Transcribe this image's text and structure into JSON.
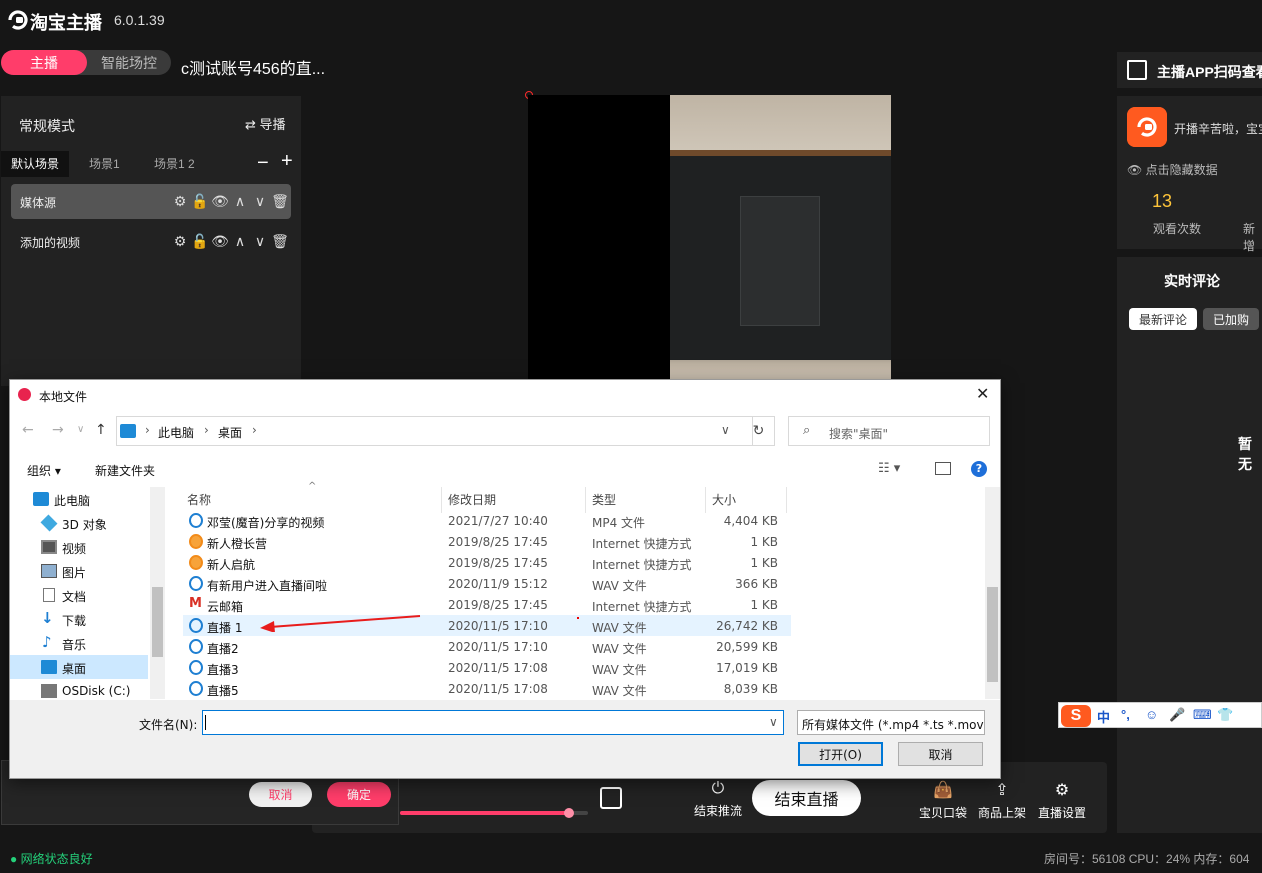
{
  "app": {
    "title": "淘宝主播",
    "version": "6.0.1.39",
    "role_tabs": [
      "主播",
      "智能场控"
    ],
    "room_title": "c测试账号456的直..."
  },
  "left_panel": {
    "mode": "常规模式",
    "director_label": "导播",
    "director_icon": "⇄",
    "scene_tabs": [
      "默认场景",
      "场景1",
      "场景1 2"
    ],
    "minus": "−",
    "plus": "+",
    "sources": [
      {
        "name": "媒体源"
      },
      {
        "name": "添加的视频"
      }
    ],
    "tool_icons": [
      "⚙",
      "🔓",
      "👁",
      "∧",
      "∨",
      "🗑"
    ]
  },
  "right_panel": {
    "qr_label": "主播APP扫码查看",
    "hello": "开播辛苦啦，宝宝",
    "hide_data": "点击隐藏数据",
    "views_value": "13",
    "views_label": "观看次数",
    "new_label": "新增",
    "comments_title": "实时评论",
    "tab_latest": "最新评论",
    "tab_cart": "已加购",
    "empty_text": "暂无"
  },
  "control_bar": {
    "volume_level": 0.9,
    "stop_push": "结束推流",
    "end_live": "结束直播",
    "bag": "宝贝口袋",
    "listing": "商品上架",
    "settings": "直播设置",
    "stop_icon": "⏻",
    "bag_icon": "👜",
    "listing_icon": "⇪",
    "settings_icon": "⚙"
  },
  "popup": {
    "cancel": "取消",
    "ok": "确定"
  },
  "status": {
    "network": "● 网络状态良好",
    "system": "房间号：56108  CPU：24%  内存：604"
  },
  "ime": {
    "logo": "S",
    "items": [
      "中",
      "°,",
      "☺",
      "🎤",
      "⌨",
      "👕"
    ]
  },
  "dialog": {
    "title": "本地文件",
    "close": "✕",
    "breadcrumb": [
      "此电脑",
      "桌面"
    ],
    "search_placeholder": "搜索\"桌面\"",
    "organize": "组织 ▾",
    "new_folder": "新建文件夹",
    "view_icon": "☷ ▾",
    "help": "?",
    "tree": [
      {
        "label": "此电脑",
        "icon": "pc-icon",
        "color": "#1e8ad6"
      },
      {
        "label": "3D 对象",
        "icon": "cube-icon",
        "color": "#3fa9e0"
      },
      {
        "label": "视频",
        "icon": "video-folder-icon",
        "color": "#555"
      },
      {
        "label": "图片",
        "icon": "pictures-folder-icon",
        "color": "#6b8fb3"
      },
      {
        "label": "文档",
        "icon": "documents-folder-icon",
        "color": "#8aa"
      },
      {
        "label": "下载",
        "icon": "download-icon",
        "color": "#1e7fd2"
      },
      {
        "label": "音乐",
        "icon": "music-icon",
        "color": "#1e7fd2"
      },
      {
        "label": "桌面",
        "icon": "desktop-icon",
        "color": "#1e8ad6"
      },
      {
        "label": "OSDisk (C:)",
        "icon": "disk-icon",
        "color": "#777"
      }
    ],
    "columns": [
      "名称",
      "修改日期",
      "类型",
      "大小"
    ],
    "files": [
      {
        "name": "邓莹(魔音)分享的视频",
        "date": "2021/7/27 10:40",
        "type": "MP4 文件",
        "size": "4,404 KB",
        "icon": "media-file-icon"
      },
      {
        "name": "新人橙长营",
        "date": "2019/8/25 17:45",
        "type": "Internet 快捷方式",
        "size": "1 KB",
        "icon": "shortcut-icon"
      },
      {
        "name": "新人启航",
        "date": "2019/8/25 17:45",
        "type": "Internet 快捷方式",
        "size": "1 KB",
        "icon": "shortcut-icon"
      },
      {
        "name": "有新用户进入直播间啦",
        "date": "2020/11/9 15:12",
        "type": "WAV 文件",
        "size": "366 KB",
        "icon": "media-file-icon"
      },
      {
        "name": "云邮箱",
        "date": "2019/8/25 17:45",
        "type": "Internet 快捷方式",
        "size": "1 KB",
        "icon": "mail-shortcut-icon"
      },
      {
        "name": "直播 1",
        "date": "2020/11/5 17:10",
        "type": "WAV 文件",
        "size": "26,742 KB",
        "icon": "media-file-icon"
      },
      {
        "name": "直播2",
        "date": "2020/11/5 17:10",
        "type": "WAV 文件",
        "size": "20,599 KB",
        "icon": "media-file-icon"
      },
      {
        "name": "直播3",
        "date": "2020/11/5 17:08",
        "type": "WAV 文件",
        "size": "17,019 KB",
        "icon": "media-file-icon"
      },
      {
        "name": "直播5",
        "date": "2020/11/5 17:08",
        "type": "WAV 文件",
        "size": "8,039 KB",
        "icon": "media-file-icon"
      }
    ],
    "filename_label": "文件名(N):",
    "filename_value": "",
    "filetype": "所有媒体文件 (*.mp4 *.ts *.mov",
    "open": "打开(O)",
    "cancel": "取消"
  },
  "colors": {
    "accent": "#ff3d6a",
    "win_blue": "#0078d7",
    "annotation": "#e81c1c"
  }
}
